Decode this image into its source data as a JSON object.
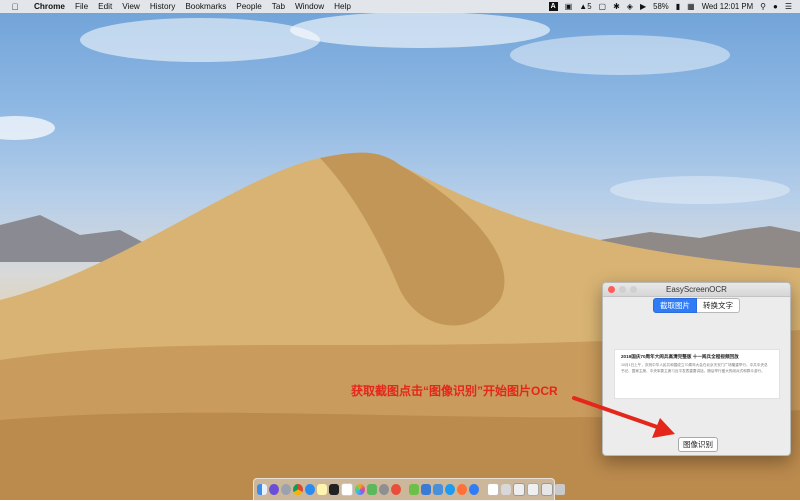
{
  "menubar": {
    "app_name": "Chrome",
    "items": [
      "File",
      "Edit",
      "View",
      "History",
      "Bookmarks",
      "People",
      "Tab",
      "Window",
      "Help"
    ],
    "status": {
      "input_badge": "A",
      "adobe_label": "5",
      "battery": "58%",
      "datetime": "Wed 12:01 PM"
    }
  },
  "window": {
    "title": "EasyScreenOCR",
    "tabs": [
      {
        "label": "截取图片",
        "active": true
      },
      {
        "label": "转换文字",
        "active": false
      }
    ],
    "preview": {
      "heading": "2019国庆70周年大阅兵高清完整版 十一阅兵全程视频回放",
      "body": "10月1日上午，庆祝中华人民共和国成立70周年大会在北京天安门广场隆重举行。中共中央总书记、国家主席、中央军委主席习近平发表重要讲话，随后举行盛大的阅兵式和群众游行。"
    },
    "ocr_button": "图像识别"
  },
  "annotation": {
    "text": "获取截图点击“图像识别”开始图片OCR",
    "color": "#e5261b"
  },
  "colors": {
    "accent": "#2f7cf6",
    "annotation": "#e5261b"
  }
}
